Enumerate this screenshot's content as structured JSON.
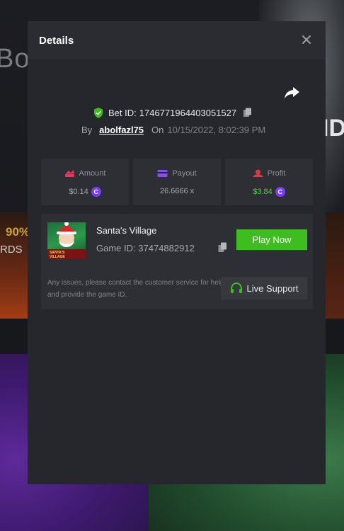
{
  "background": {
    "promo_text": "Bon",
    "right_text": "ID",
    "percent_text": "90%",
    "rewards_text": "RDS"
  },
  "modal": {
    "title": "Details",
    "bet_label": "Bet ID:",
    "bet_id": "1746771964403051527",
    "by_label": "By",
    "username": "abolfazl75",
    "on_label": "On",
    "date": "10/15/2022, 8:02:39 PM",
    "stats": {
      "amount_label": "Amount",
      "amount_value": "$0.14",
      "payout_label": "Payout",
      "payout_value": "26.6666 x",
      "profit_label": "Profit",
      "profit_value": "$3.84"
    },
    "game": {
      "name": "Santa's Village",
      "id_label": "Game ID:",
      "id": "37474882912",
      "thumb_text": "SANTA'S VILLAGE",
      "play_label": "Play Now"
    },
    "issues_text": "Any issues, please contact the customer service for help and provide the game ID.",
    "support_label": "Live Support"
  },
  "colors": {
    "accent_green": "#3ebd1e",
    "profit_green": "#4fd341",
    "coin_purple": "#7a3cff",
    "amount_pink": "#e0395b",
    "payout_purple": "#8a4bff",
    "profit_red": "#e03a3a"
  },
  "icons": [
    "close-icon",
    "share-icon",
    "shield-check-icon",
    "copy-icon",
    "amount-icon",
    "payout-card-icon",
    "profit-icon",
    "coin-icon",
    "headset-icon"
  ]
}
